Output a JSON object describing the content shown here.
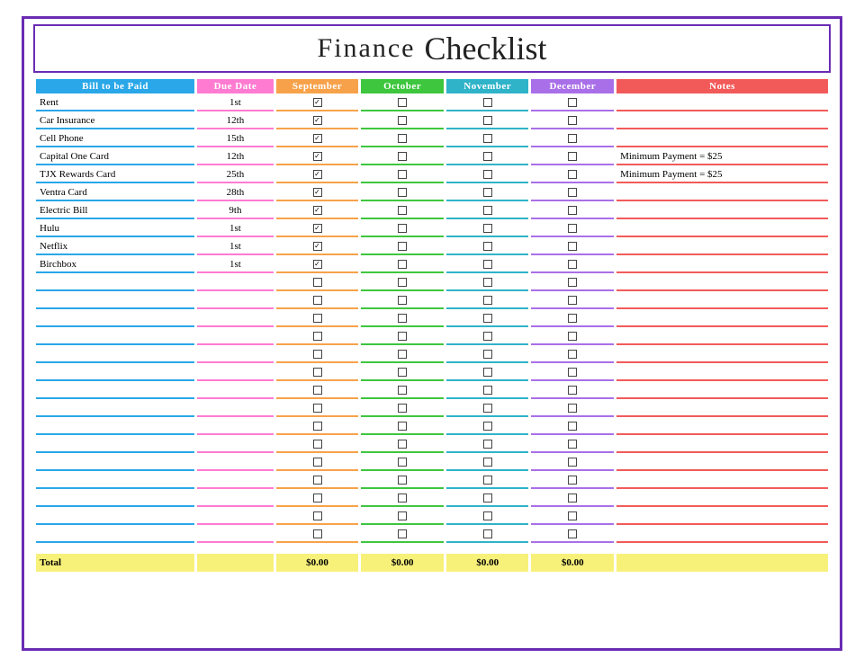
{
  "title": {
    "word1": "Finance",
    "word2": "Checklist"
  },
  "headers": {
    "bill": "Bill to be Paid",
    "due": "Due Date",
    "sep": "September",
    "oct": "October",
    "nov": "November",
    "dec": "December",
    "notes": "Notes"
  },
  "rows": [
    {
      "bill": "Rent",
      "due": "1st",
      "sep": true,
      "oct": false,
      "nov": false,
      "dec": false,
      "notes": ""
    },
    {
      "bill": "Car Insurance",
      "due": "12th",
      "sep": true,
      "oct": false,
      "nov": false,
      "dec": false,
      "notes": ""
    },
    {
      "bill": "Cell Phone",
      "due": "15th",
      "sep": true,
      "oct": false,
      "nov": false,
      "dec": false,
      "notes": ""
    },
    {
      "bill": "Capital One Card",
      "due": "12th",
      "sep": true,
      "oct": false,
      "nov": false,
      "dec": false,
      "notes": "Minimum Payment = $25"
    },
    {
      "bill": "TJX Rewards Card",
      "due": "25th",
      "sep": true,
      "oct": false,
      "nov": false,
      "dec": false,
      "notes": "Minimum Payment = $25"
    },
    {
      "bill": "Ventra Card",
      "due": "28th",
      "sep": true,
      "oct": false,
      "nov": false,
      "dec": false,
      "notes": ""
    },
    {
      "bill": "Electric Bill",
      "due": "9th",
      "sep": true,
      "oct": false,
      "nov": false,
      "dec": false,
      "notes": ""
    },
    {
      "bill": "Hulu",
      "due": "1st",
      "sep": true,
      "oct": false,
      "nov": false,
      "dec": false,
      "notes": ""
    },
    {
      "bill": "Netflix",
      "due": "1st",
      "sep": true,
      "oct": false,
      "nov": false,
      "dec": false,
      "notes": ""
    },
    {
      "bill": "Birchbox",
      "due": "1st",
      "sep": true,
      "oct": false,
      "nov": false,
      "dec": false,
      "notes": ""
    },
    {
      "bill": "",
      "due": "",
      "sep": false,
      "oct": false,
      "nov": false,
      "dec": false,
      "notes": ""
    },
    {
      "bill": "",
      "due": "",
      "sep": false,
      "oct": false,
      "nov": false,
      "dec": false,
      "notes": ""
    },
    {
      "bill": "",
      "due": "",
      "sep": false,
      "oct": false,
      "nov": false,
      "dec": false,
      "notes": ""
    },
    {
      "bill": "",
      "due": "",
      "sep": false,
      "oct": false,
      "nov": false,
      "dec": false,
      "notes": ""
    },
    {
      "bill": "",
      "due": "",
      "sep": false,
      "oct": false,
      "nov": false,
      "dec": false,
      "notes": ""
    },
    {
      "bill": "",
      "due": "",
      "sep": false,
      "oct": false,
      "nov": false,
      "dec": false,
      "notes": ""
    },
    {
      "bill": "",
      "due": "",
      "sep": false,
      "oct": false,
      "nov": false,
      "dec": false,
      "notes": ""
    },
    {
      "bill": "",
      "due": "",
      "sep": false,
      "oct": false,
      "nov": false,
      "dec": false,
      "notes": ""
    },
    {
      "bill": "",
      "due": "",
      "sep": false,
      "oct": false,
      "nov": false,
      "dec": false,
      "notes": ""
    },
    {
      "bill": "",
      "due": "",
      "sep": false,
      "oct": false,
      "nov": false,
      "dec": false,
      "notes": ""
    },
    {
      "bill": "",
      "due": "",
      "sep": false,
      "oct": false,
      "nov": false,
      "dec": false,
      "notes": ""
    },
    {
      "bill": "",
      "due": "",
      "sep": false,
      "oct": false,
      "nov": false,
      "dec": false,
      "notes": ""
    },
    {
      "bill": "",
      "due": "",
      "sep": false,
      "oct": false,
      "nov": false,
      "dec": false,
      "notes": ""
    },
    {
      "bill": "",
      "due": "",
      "sep": false,
      "oct": false,
      "nov": false,
      "dec": false,
      "notes": ""
    },
    {
      "bill": "",
      "due": "",
      "sep": false,
      "oct": false,
      "nov": false,
      "dec": false,
      "notes": ""
    }
  ],
  "totals": {
    "label": "Total",
    "sep": "$0.00",
    "oct": "$0.00",
    "nov": "$0.00",
    "dec": "$0.00"
  }
}
